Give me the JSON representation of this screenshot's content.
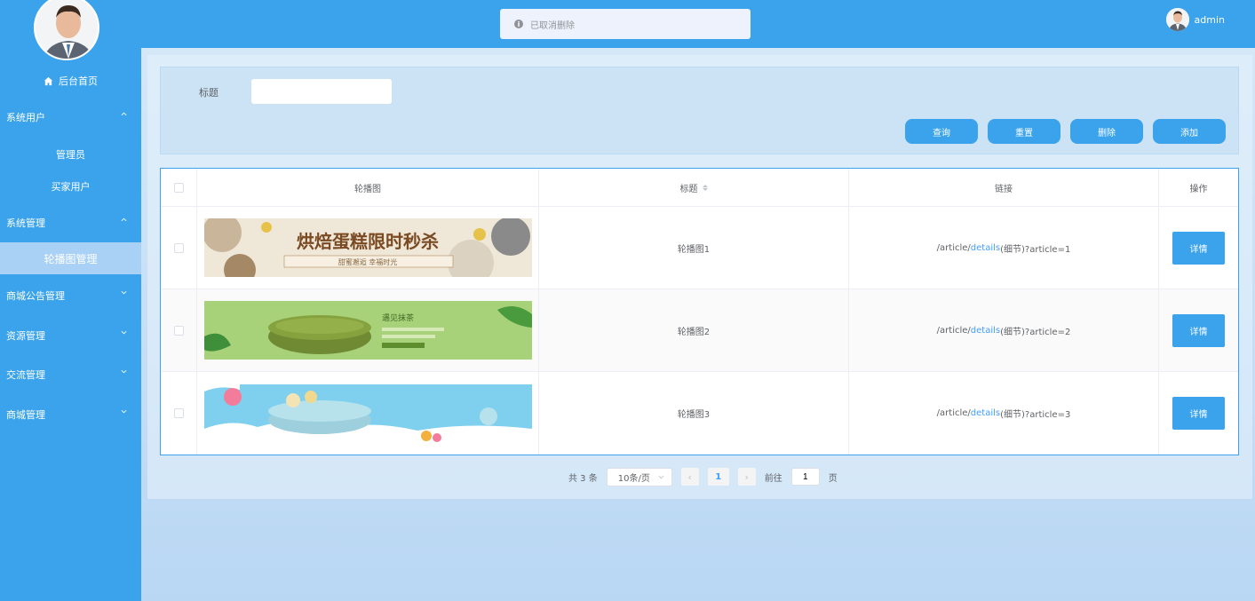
{
  "sidebar": {
    "home_label": "后台首页",
    "groups": [
      {
        "label": "系统用户",
        "expanded": true,
        "items": [
          "管理员",
          "买家用户"
        ]
      },
      {
        "label": "系统管理",
        "expanded": true,
        "items": [
          "轮播图管理"
        ]
      },
      {
        "label": "商城公告管理",
        "expanded": false,
        "items": []
      },
      {
        "label": "资源管理",
        "expanded": false,
        "items": []
      },
      {
        "label": "交流管理",
        "expanded": false,
        "items": []
      },
      {
        "label": "商城管理",
        "expanded": false,
        "items": []
      }
    ],
    "active_item": "轮播图管理"
  },
  "topbar": {
    "toast_message": "已取消删除",
    "username": "admin"
  },
  "search": {
    "title_label": "标题",
    "title_value": "",
    "buttons": {
      "query": "查询",
      "reset": "重置",
      "delete": "删除",
      "add": "添加"
    }
  },
  "table": {
    "columns": [
      "轮播图",
      "标题",
      "链接",
      "操作"
    ],
    "rows": [
      {
        "banner_text": "烘焙蛋糕限时秒杀",
        "banner_sub": "甜蜜邂逅 幸福时光",
        "title": "轮播图1",
        "link_prefix": "/article/",
        "link_hl": "details",
        "link_suffix": "(细节)?article=1",
        "action": "详情"
      },
      {
        "banner_text": "遇见抹茶",
        "banner_sub": "",
        "title": "轮播图2",
        "link_prefix": "/article/",
        "link_hl": "details",
        "link_suffix": "(细节)?article=2",
        "action": "详情"
      },
      {
        "banner_text": "",
        "banner_sub": "",
        "title": "轮播图3",
        "link_prefix": "/article/",
        "link_hl": "details",
        "link_suffix": "(细节)?article=3",
        "action": "详情"
      }
    ]
  },
  "pagination": {
    "total_text": "共 3 条",
    "page_size": "10条/页",
    "current_page": "1",
    "goto_label": "前往",
    "goto_value": "1",
    "page_unit": "页"
  },
  "colors": {
    "primary": "#3aa3ec",
    "link": "#409eff"
  }
}
